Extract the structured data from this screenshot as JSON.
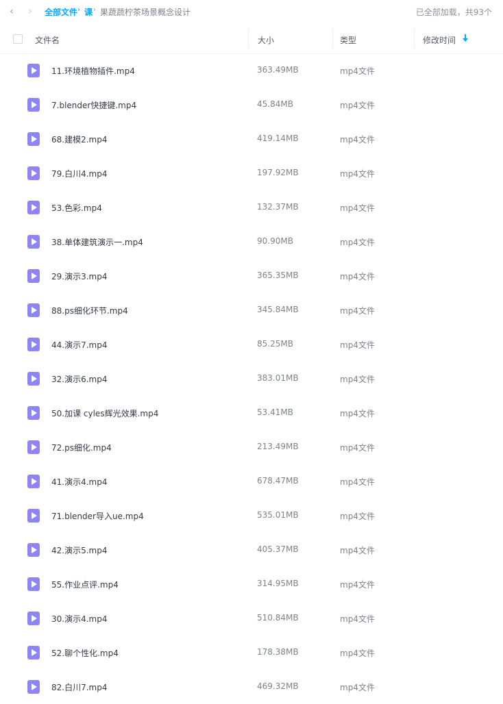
{
  "nav": {
    "back_glyph": "‹",
    "forward_glyph": "›"
  },
  "breadcrumb": {
    "root": "全部文件",
    "middle": "课",
    "current": "果蔬蔬柠茶场景概念设计",
    "separator": "›"
  },
  "status": "已全部加载，共93个",
  "columns": {
    "name": "文件名",
    "size": "大小",
    "type": "类型",
    "modified": "修改时间"
  },
  "colors": {
    "accent": "#06a7ff",
    "video_icon": "#8e84f5"
  },
  "files": [
    {
      "name": "11.环境植物插件.mp4",
      "size": "363.49MB",
      "type": "mp4文件"
    },
    {
      "name": "7.blender快捷键.mp4",
      "size": "45.84MB",
      "type": "mp4文件"
    },
    {
      "name": "68.建模2.mp4",
      "size": "419.14MB",
      "type": "mp4文件"
    },
    {
      "name": "79.白川4.mp4",
      "size": "197.92MB",
      "type": "mp4文件"
    },
    {
      "name": "53.色彩.mp4",
      "size": "132.37MB",
      "type": "mp4文件"
    },
    {
      "name": "38.单体建筑演示一.mp4",
      "size": "90.90MB",
      "type": "mp4文件"
    },
    {
      "name": "29.演示3.mp4",
      "size": "365.35MB",
      "type": "mp4文件"
    },
    {
      "name": "88.ps细化环节.mp4",
      "size": "345.84MB",
      "type": "mp4文件"
    },
    {
      "name": "44.演示7.mp4",
      "size": "85.25MB",
      "type": "mp4文件"
    },
    {
      "name": "32.演示6.mp4",
      "size": "383.01MB",
      "type": "mp4文件"
    },
    {
      "name": "50.加课 cyles辉光效果.mp4",
      "size": "53.41MB",
      "type": "mp4文件"
    },
    {
      "name": "72.ps细化.mp4",
      "size": "213.49MB",
      "type": "mp4文件"
    },
    {
      "name": "41.演示4.mp4",
      "size": "678.47MB",
      "type": "mp4文件"
    },
    {
      "name": "71.blender导入ue.mp4",
      "size": "535.01MB",
      "type": "mp4文件"
    },
    {
      "name": "42.演示5.mp4",
      "size": "405.37MB",
      "type": "mp4文件"
    },
    {
      "name": "55.作业点评.mp4",
      "size": "314.95MB",
      "type": "mp4文件"
    },
    {
      "name": "30.演示4.mp4",
      "size": "510.84MB",
      "type": "mp4文件"
    },
    {
      "name": "52.聊个性化.mp4",
      "size": "178.38MB",
      "type": "mp4文件"
    },
    {
      "name": "82.白川7.mp4",
      "size": "469.32MB",
      "type": "mp4文件"
    }
  ]
}
